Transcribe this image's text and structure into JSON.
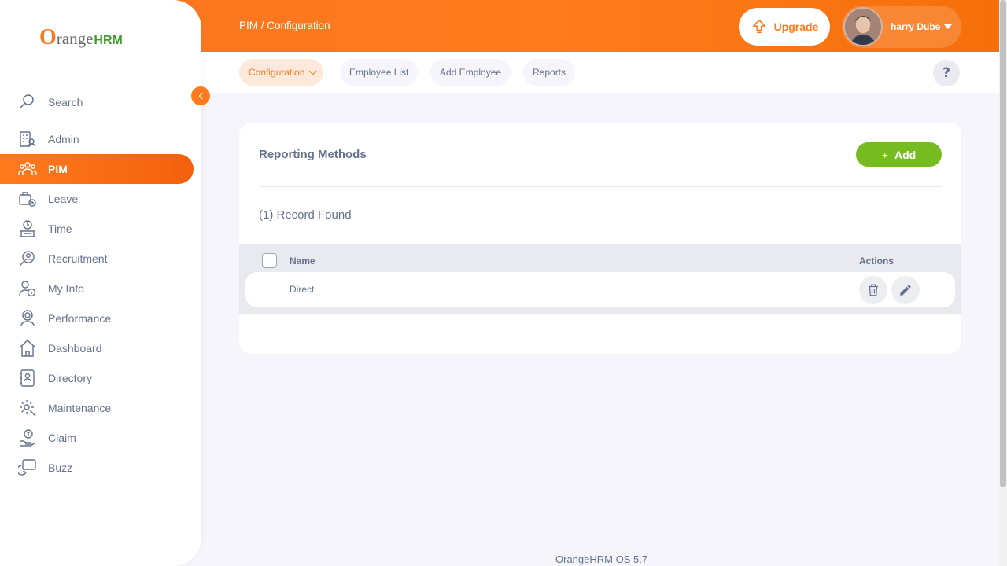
{
  "app": {
    "logo_o": "O",
    "logo_text": "range",
    "logo_hrm": "HRM",
    "footer": "OrangeHRM OS 5.7"
  },
  "header": {
    "breadcrumb_module": "PIM",
    "breadcrumb_separator": " / ",
    "breadcrumb_page": "Configuration",
    "upgrade_label": "Upgrade",
    "user_name": "harry Dube",
    "accent_color": "#ff7b1d"
  },
  "subnav": {
    "tabs": [
      {
        "label": "Configuration",
        "active": true
      },
      {
        "label": "Employee List",
        "active": false
      },
      {
        "label": "Add Employee",
        "active": false
      },
      {
        "label": "Reports",
        "active": false
      }
    ],
    "help_label": "?"
  },
  "sidebar": {
    "search_label": "Search",
    "items": [
      {
        "label": "Admin",
        "icon": "admin-icon",
        "active": false
      },
      {
        "label": "PIM",
        "icon": "pim-icon",
        "active": true
      },
      {
        "label": "Leave",
        "icon": "leave-icon",
        "active": false
      },
      {
        "label": "Time",
        "icon": "time-icon",
        "active": false
      },
      {
        "label": "Recruitment",
        "icon": "recruitment-icon",
        "active": false
      },
      {
        "label": "My Info",
        "icon": "my-info-icon",
        "active": false
      },
      {
        "label": "Performance",
        "icon": "performance-icon",
        "active": false
      },
      {
        "label": "Dashboard",
        "icon": "dashboard-icon",
        "active": false
      },
      {
        "label": "Directory",
        "icon": "directory-icon",
        "active": false
      },
      {
        "label": "Maintenance",
        "icon": "maintenance-icon",
        "active": false
      },
      {
        "label": "Claim",
        "icon": "claim-icon",
        "active": false
      },
      {
        "label": "Buzz",
        "icon": "buzz-icon",
        "active": false
      }
    ]
  },
  "main": {
    "title": "Reporting Methods",
    "add_label": "Add",
    "add_plus": "+",
    "record_count": "(1) Record Found",
    "add_button_color": "#76bc21",
    "table": {
      "columns": [
        "Name",
        "Actions"
      ],
      "rows": [
        {
          "name": "Direct"
        }
      ]
    }
  }
}
